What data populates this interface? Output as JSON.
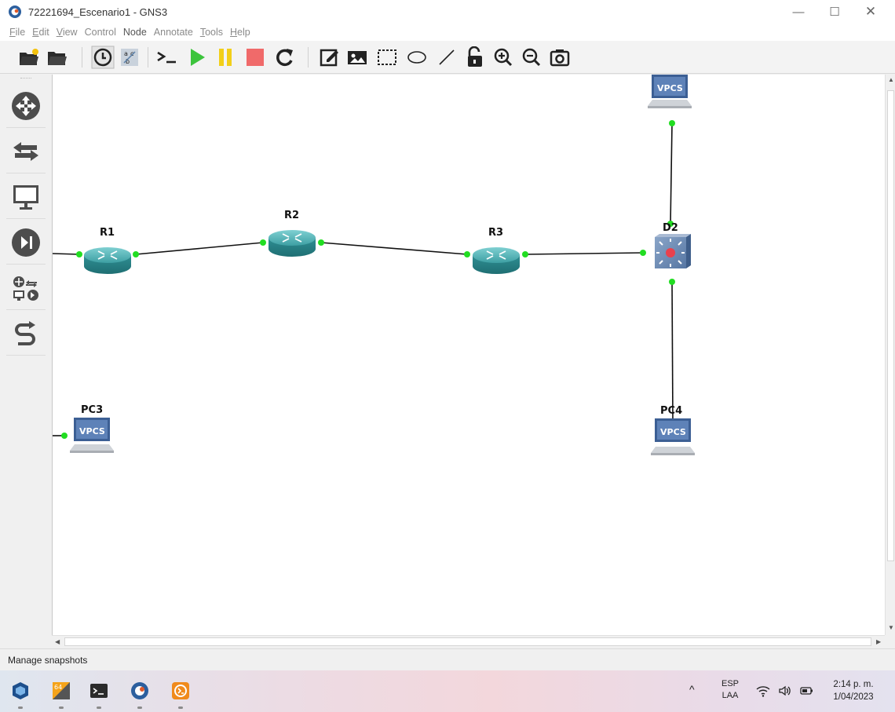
{
  "window": {
    "title": "72221694_Escenario1 - GNS3",
    "minimize": "—",
    "maximize": "☐",
    "close": "✕"
  },
  "menu": [
    {
      "label": "File",
      "ul": "F",
      "rest": "ile"
    },
    {
      "label": "Edit",
      "ul": "E",
      "rest": "dit"
    },
    {
      "label": "View",
      "ul": "V",
      "rest": "iew"
    },
    {
      "label": "Control",
      "ul": "",
      "rest": "Control"
    },
    {
      "label": "Node",
      "ul": "",
      "rest": "Node"
    },
    {
      "label": "Annotate",
      "ul": "",
      "rest": "Annotate"
    },
    {
      "label": "Tools",
      "ul": "T",
      "rest": "ools"
    },
    {
      "label": "Help",
      "ul": "H",
      "rest": "elp"
    }
  ],
  "toolbar": {
    "items": [
      "new-project",
      "open-project",
      "snapshot",
      "show-interface-labels",
      "console-all",
      "start-all",
      "suspend-all",
      "stop-all",
      "reload-all",
      "add-note",
      "insert-image",
      "draw-rectangle",
      "draw-ellipse",
      "draw-line",
      "lock",
      "zoom-in",
      "zoom-out",
      "screenshot"
    ]
  },
  "dock": {
    "items": [
      "routers",
      "switches",
      "end-devices",
      "security-devices",
      "all-devices",
      "add-link"
    ]
  },
  "topology": {
    "nodes": {
      "r1": {
        "label": "R1",
        "type": "router"
      },
      "r2": {
        "label": "R2",
        "type": "router"
      },
      "r3": {
        "label": "R3",
        "type": "router"
      },
      "d2": {
        "label": "D2",
        "type": "multilayer-switch"
      },
      "pc3": {
        "label": "PC3",
        "type": "vpcs",
        "icon_text": "VPCS"
      },
      "pc4": {
        "label": "PC4",
        "type": "vpcs",
        "icon_text": "VPCS"
      },
      "vpcs_top": {
        "label": "",
        "type": "vpcs",
        "icon_text": "VPCS"
      }
    },
    "link_status_color": "#22dd22"
  },
  "status": {
    "text": "Manage snapshots"
  },
  "taskbar": {
    "apps": [
      "virtualbox",
      "vmware-workstation",
      "terminal",
      "gns3",
      "solarwinds"
    ],
    "tray": {
      "chevron": "^",
      "lang_top": "ESP",
      "lang_bottom": "LAA",
      "time": "2:14 p. m.",
      "date": "1/04/2023"
    }
  }
}
